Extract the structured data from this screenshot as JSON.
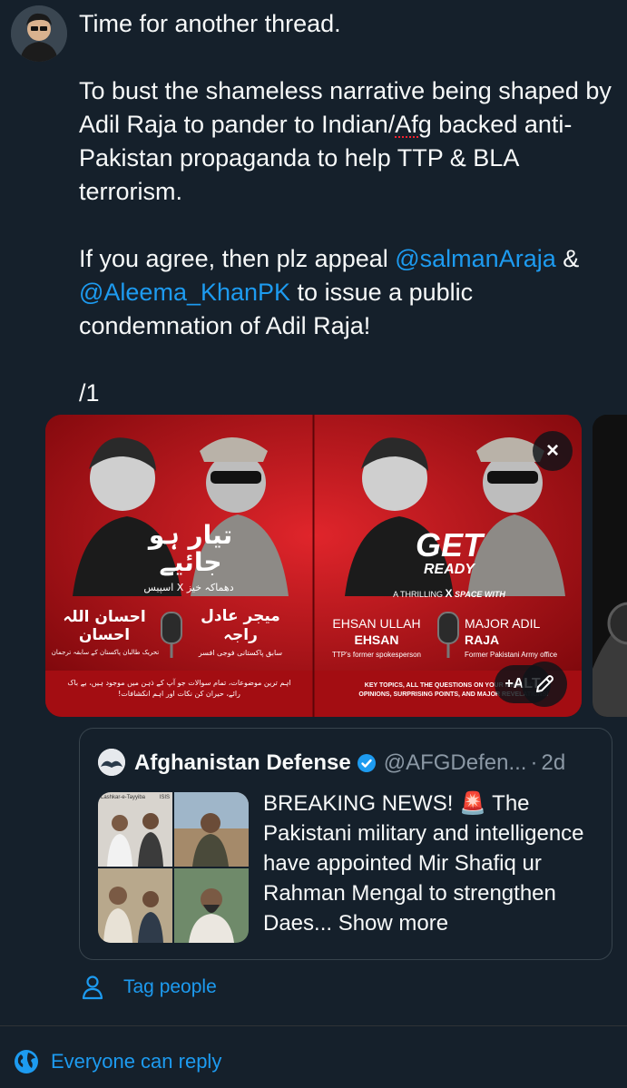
{
  "tweet": {
    "paragraphs": [
      "Time for another thread.",
      null,
      null,
      "/1"
    ],
    "p2_before": "To bust the shameless narrative being shaped by Adil Raja to pander to Indian/",
    "p2_spell": "Afg",
    "p2_after": " backed anti-Pakistan propaganda to help TTP & BLA terrorism.",
    "p3_before": "If you agree, then plz appeal ",
    "p3_mention1": "@salmanAraja",
    "p3_mid": " & ",
    "p3_mention2": "@Aleema_KhanPK",
    "p3_after": " to issue a public condemnation of Adil Raja!",
    "p4": "/1"
  },
  "media": {
    "left_urdu_title": "تیار ہو جائیے",
    "left_urdu_sub": "دھماکہ خیز X اسپیس",
    "left_name1": "احسان اللہ احسان",
    "left_name2": "میجر عادل راجہ",
    "left_role1": "تحریک طالبان پاکستان کے سابقہ ترجمان",
    "left_role2": "سابق پاکستانی فوجی افسر",
    "left_footer": "اہم ترین موضوعات، تمام سوالات جو آپ کے ذہن میں موجود ہیں، بے باک رائے، حیران کن نکات اور اہم انکشافات!",
    "get": "GET",
    "ready": "READY",
    "thrilling": "A THRILLING",
    "x_mark": "X",
    "space_with": "SPACE WITH",
    "guest1_first": "EHSAN ULLAH",
    "guest1_last": "EHSAN",
    "guest1_role": "TTP's former spokesperson",
    "guest2_first": "MAJOR ADIL",
    "guest2_last": "RAJA",
    "guest2_role": "Former Pakistani Army office",
    "footer": "KEY TOPICS, ALL THE QUESTIONS ON YOUR MIND, BOLD OPINIONS, SURPRISING POINTS, AND MAJOR REVELATIONS!",
    "alt_label": "+ALT",
    "close_icon": "×"
  },
  "quote": {
    "name": "Afghanistan Defense",
    "handle": "@AFGDefen...",
    "sep": "·",
    "time": "2d",
    "text": "BREAKING NEWS! 🚨 The Pakistani military and intelligence have appointed Mir Shafiq ur Rahman Mengal to strengthen Daes...",
    "show_more": "Show more",
    "thumb_labels": [
      "Lashkar-e-Tayyiba",
      "ISIS"
    ]
  },
  "actions": {
    "tag_people": "Tag people",
    "reply_setting": "Everyone can reply"
  },
  "colors": {
    "accent": "#1d9bf0",
    "background": "#15202b",
    "poster_red": "#c4161c"
  }
}
